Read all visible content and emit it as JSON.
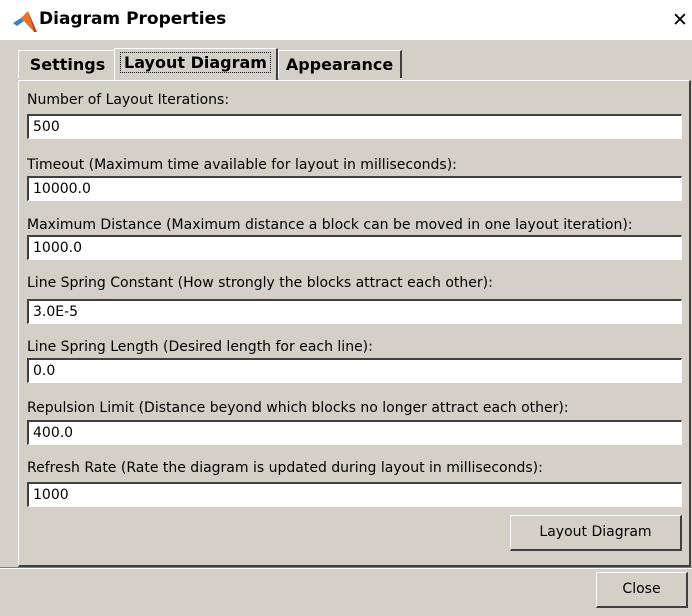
{
  "window": {
    "title": "Diagram Properties",
    "icon": "matlab-logo-icon",
    "close_glyph": "✕"
  },
  "tabs": [
    {
      "label": "Settings",
      "active": false
    },
    {
      "label": "Layout Diagram",
      "active": true
    },
    {
      "label": "Appearance",
      "active": false
    }
  ],
  "fields": [
    {
      "label": "Number of Layout Iterations:",
      "value": "500"
    },
    {
      "label": "Timeout (Maximum time available for layout in milliseconds):",
      "value": "10000.0"
    },
    {
      "label": "Maximum Distance (Maximum distance a block can be moved in one layout iteration):",
      "value": "1000.0"
    },
    {
      "label": "Line Spring Constant (How strongly the blocks attract each other):",
      "value": "3.0E-5"
    },
    {
      "label": "Line Spring Length (Desired length for each line):",
      "value": "0.0"
    },
    {
      "label": "Repulsion Limit (Distance beyond which blocks no longer attract each other):",
      "value": "400.0"
    },
    {
      "label": "Refresh Rate (Rate the diagram is updated during layout in milliseconds):",
      "value": "1000"
    }
  ],
  "buttons": {
    "layout": "Layout Diagram",
    "close": "Close"
  }
}
